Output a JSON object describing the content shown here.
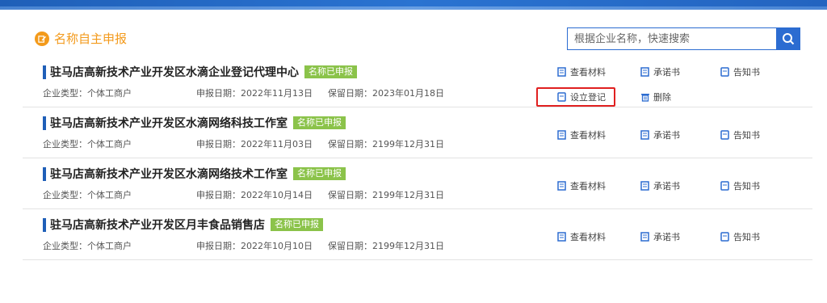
{
  "page": {
    "section_title": "名称自主申报",
    "search_placeholder": "根据企业名称，快速搜索"
  },
  "colors": {
    "accent_orange": "#f39a1b",
    "primary_blue": "#2c6cd1",
    "status_green": "#8bc34a",
    "highlight_red": "#e02020"
  },
  "records": [
    {
      "name": "驻马店高新技术产业开发区水滴企业登记代理中心",
      "status": "名称已申报",
      "enterprise_type": "企业类型：个体工商户",
      "apply_date": "申报日期：2022年11月13日",
      "reserve_date": "保留日期：2023年01月18日",
      "actions": {
        "view": "查看材料",
        "promise": "承诺书",
        "notice": "告知书",
        "register": "设立登记",
        "delete": "删除"
      }
    },
    {
      "name": "驻马店高新技术产业开发区水滴网络科技工作室",
      "status": "名称已申报",
      "enterprise_type": "企业类型：个体工商户",
      "apply_date": "申报日期：2022年11月03日",
      "reserve_date": "保留日期：2199年12月31日",
      "actions": {
        "view": "查看材料",
        "promise": "承诺书",
        "notice": "告知书"
      }
    },
    {
      "name": "驻马店高新技术产业开发区水滴网络技术工作室",
      "status": "名称已申报",
      "enterprise_type": "企业类型：个体工商户",
      "apply_date": "申报日期：2022年10月14日",
      "reserve_date": "保留日期：2199年12月31日",
      "actions": {
        "view": "查看材料",
        "promise": "承诺书",
        "notice": "告知书"
      }
    },
    {
      "name": "驻马店高新技术产业开发区月丰食品销售店",
      "status": "名称已申报",
      "enterprise_type": "企业类型：个体工商户",
      "apply_date": "申报日期：2022年10月10日",
      "reserve_date": "保留日期：2199年12月31日",
      "actions": {
        "view": "查看材料",
        "promise": "承诺书",
        "notice": "告知书"
      }
    }
  ]
}
